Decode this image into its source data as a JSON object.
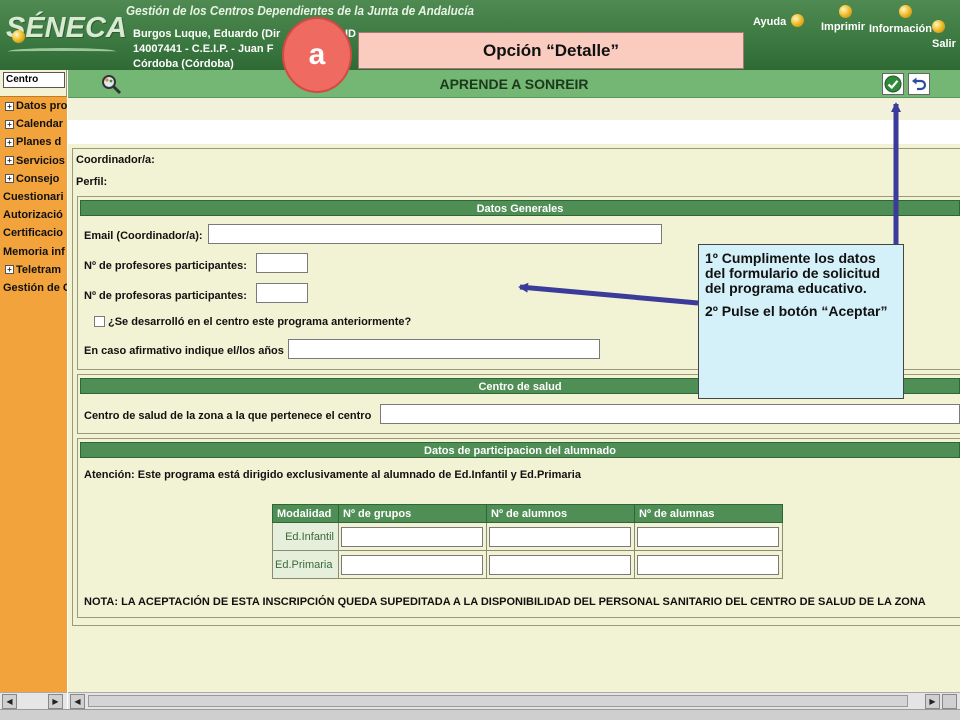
{
  "header": {
    "app_title": "Gestión de los Centros Dependientes de la Junta de Andalucía",
    "logo": "SÉNECA",
    "user_name": "Burgos Luque, Eduardo (Dir",
    "user_name_tail": "ID",
    "user_school": "14007441 - C.E.I.P. - Juan F",
    "user_city": "Córdoba (Córdoba)",
    "links": {
      "ayuda": "Ayuda",
      "imprimir": "Imprimir",
      "informacion": "Información",
      "salir": "Salir"
    }
  },
  "overlay": {
    "badge": "a",
    "option_label": "Opción “Detalle”",
    "note_lines": [
      "1º Cumplimente los datos del formulario de solicitud del programa educativo.",
      "2º Pulse el botón “Aceptar”"
    ]
  },
  "sidebar": {
    "select_value": "Centro",
    "items": [
      {
        "label": "Datos pro",
        "expandable": true
      },
      {
        "label": "Calendar",
        "expandable": true
      },
      {
        "label": "Planes d",
        "expandable": true
      },
      {
        "label": "Servicios",
        "expandable": true
      },
      {
        "label": "Consejo",
        "expandable": true
      },
      {
        "label": "Cuestionari",
        "expandable": false
      },
      {
        "label": "Autorizació",
        "expandable": false
      },
      {
        "label": "Certificacio",
        "expandable": false
      },
      {
        "label": "Memoria inf",
        "expandable": false
      },
      {
        "label": "Teletram",
        "expandable": true
      },
      {
        "label": "Gestión de C",
        "expandable": false
      }
    ]
  },
  "titlebar": {
    "title": "APRENDE A SONREIR"
  },
  "form": {
    "coordinator_label": "Coordinador/a:",
    "profile_label": "Perfil:",
    "general": {
      "title": "Datos Generales",
      "email_label": "Email (Coordinador/a):",
      "teachers_m_label": "Nº de profesores participantes:",
      "teachers_f_label": "Nº de profesoras participantes:",
      "previous_label": "¿Se desarrolló en el centro este programa anteriormente?",
      "years_label": "En caso afirmativo indique el/los años"
    },
    "health": {
      "title": "Centro de salud",
      "center_label": "Centro de salud de la zona a la que pertenece el centro"
    },
    "participation": {
      "title": "Datos de participacion del alumnado",
      "attention": "Atención: Este programa está dirigido exclusivamente al alumnado de Ed.Infantil y Ed.Primaria",
      "columns": [
        "Modalidad",
        "Nº de grupos",
        "Nº de alumnos",
        "Nº de alumnas"
      ],
      "rows": [
        "Ed.Infantil",
        "Ed.Primaria"
      ],
      "note": "NOTA: LA ACEPTACIÓN DE ESTA INSCRIPCIÓN QUEDA SUPEDITADA A LA DISPONIBILIDAD DEL PERSONAL SANITARIO DEL CENTRO DE SALUD DE LA ZONA"
    }
  },
  "colors": {
    "header_green": "#3d7a42",
    "title_green": "#74b674",
    "section_green": "#4f8e54",
    "sidebar_orange": "#f2a33b",
    "form_bg": "#f2f2d5",
    "badge_red": "#ef6a61",
    "option_bg": "#f9ccbf",
    "note_bg": "#d4f0f8",
    "arrow": "#3b3b9a"
  },
  "icons": {
    "search": "search-icon",
    "accept": "check-icon",
    "back": "undo-icon"
  }
}
